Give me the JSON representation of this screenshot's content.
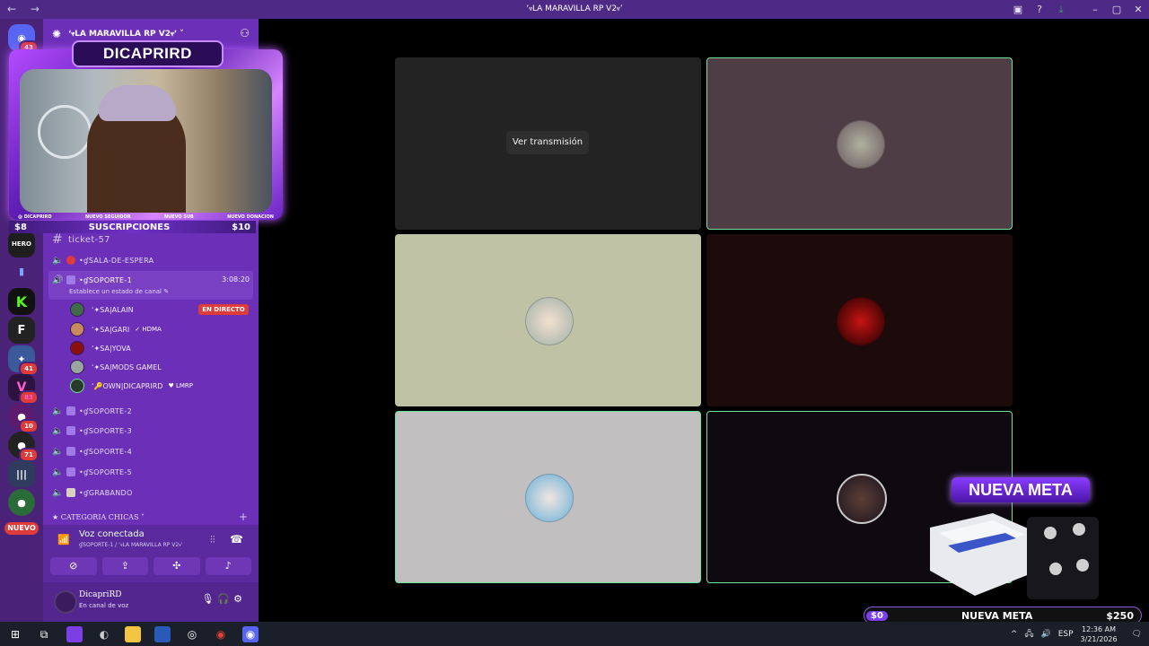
{
  "window": {
    "title": "ʻⳡLA MARAVILLA RP V2ⳡʼ",
    "nav": "← →"
  },
  "rail": {
    "badges": [
      "43",
      "41",
      "83",
      "10",
      "71"
    ],
    "nuevo_label": "NUEVO"
  },
  "server": {
    "name": "ʻⳡLA MARAVILLA RP V2ⳡʼ ˅"
  },
  "channels": {
    "ticket": "ticket-57",
    "sala": "•ɠSALA-DE-ESPERA",
    "soporte1": "•ɠSOPORTE-1",
    "soporte1_timer": "3:08:20",
    "soporte1_status": "Establece un estado de canal ✎",
    "soporte2": "•ɠSOPORTE-2",
    "soporte3": "•ɠSOPORTE-3",
    "soporte4": "•ɠSOPORTE-4",
    "soporte5": "•ɠSOPORTE-5",
    "grabando": "•ɠGRABANDO",
    "category": "★ CATEGORIA CHICAS ˅"
  },
  "voice_users": [
    {
      "name": "ʻ✦SA|ALAIN",
      "tag": ""
    },
    {
      "name": "ʻ✦SA|GARI",
      "tag": "✓ HDMA"
    },
    {
      "name": "ʻ✦SA|YOVA",
      "tag": ""
    },
    {
      "name": "ʻ✦SA|MODS GAMEL",
      "tag": ""
    },
    {
      "name": "ʻ🔑OWN|DICAPRIRD",
      "tag": "♥ LMRP"
    }
  ],
  "live_badge": "EN DIRECTO",
  "voice_panel": {
    "title": "Voz conectada",
    "subtitle": "ɠSOPORTE-1 / ʻⳡLA MARAVILLA RP V2ⳡʼ"
  },
  "user_panel": {
    "username": "DicapriRD",
    "status": "En canal de voz"
  },
  "overlay": {
    "banner": "DICAPRIRD",
    "labels": [
      "@ DICAPRIRD",
      "NUEVO SEGUIDOR",
      "NUEVO SUB",
      "NUEVO DONACION"
    ],
    "subs_left": "$8",
    "subs_title": "SUSCRIPCIONES",
    "subs_right": "$10"
  },
  "grid": {
    "watch_label": "Ver transmisión",
    "tile_colors": [
      "#232323",
      "#4e3d45",
      "#bfc2a5",
      "#1d0a0a",
      "#c1bfc0",
      "#0e0a10"
    ],
    "speaking": [
      false,
      true,
      false,
      false,
      true,
      true
    ]
  },
  "goal": {
    "title": "NUEVA META",
    "start": "$0",
    "label": "NUEVA META",
    "end": "$250",
    "progress": 0
  },
  "taskbar": {
    "lang": "ESP",
    "time": "12:36 AM",
    "date": "3/21/2026",
    "notif": "1"
  }
}
